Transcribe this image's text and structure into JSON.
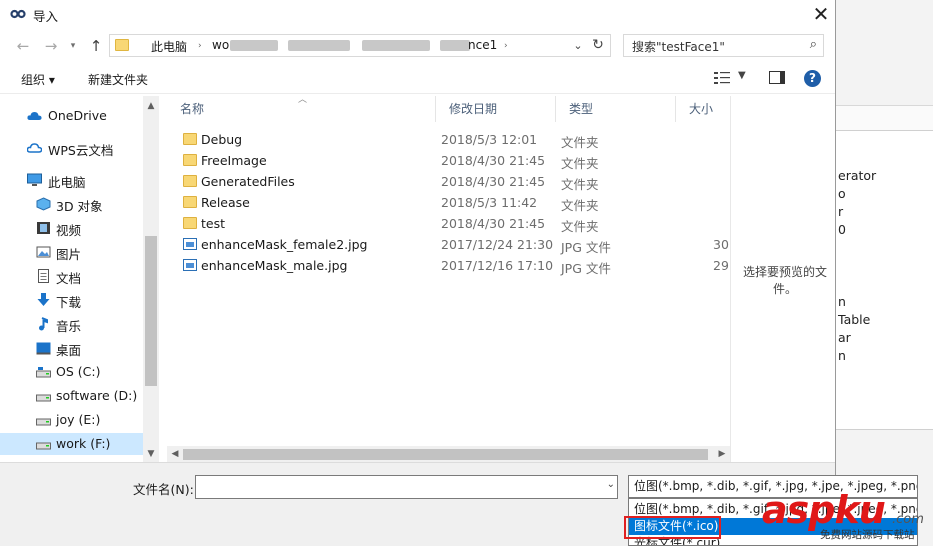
{
  "window": {
    "title": "导入"
  },
  "address": {
    "crumbs": [
      "此电脑",
      "wo",
      "nce1"
    ]
  },
  "search": {
    "placeholder": "搜索\"testFace1\""
  },
  "toolbar": {
    "organize": "组织 ▾",
    "new_folder": "新建文件夹"
  },
  "nav": {
    "items": [
      {
        "label": "OneDrive",
        "icon": "cloud-icon"
      },
      {
        "label": "WPS云文档",
        "icon": "cloud-icon"
      },
      {
        "label": "此电脑",
        "icon": "computer-icon"
      },
      {
        "label": "3D 对象",
        "icon": "cube-icon"
      },
      {
        "label": "视频",
        "icon": "video-icon"
      },
      {
        "label": "图片",
        "icon": "picture-icon"
      },
      {
        "label": "文档",
        "icon": "document-icon"
      },
      {
        "label": "下载",
        "icon": "download-icon"
      },
      {
        "label": "音乐",
        "icon": "music-icon"
      },
      {
        "label": "桌面",
        "icon": "desktop-icon"
      },
      {
        "label": "OS (C:)",
        "icon": "drive-icon"
      },
      {
        "label": "software (D:)",
        "icon": "drive-icon"
      },
      {
        "label": "joy (E:)",
        "icon": "drive-icon"
      },
      {
        "label": "work (F:)",
        "icon": "drive-icon",
        "selected": true
      }
    ]
  },
  "columns": {
    "name": "名称",
    "date": "修改日期",
    "type": "类型",
    "size": "大小"
  },
  "files": [
    {
      "name": "Debug",
      "date": "2018/5/3 12:01",
      "type": "文件夹",
      "size": "",
      "kind": "folder"
    },
    {
      "name": "FreeImage",
      "date": "2018/4/30 21:45",
      "type": "文件夹",
      "size": "",
      "kind": "folder"
    },
    {
      "name": "GeneratedFiles",
      "date": "2018/4/30 21:45",
      "type": "文件夹",
      "size": "",
      "kind": "folder"
    },
    {
      "name": "Release",
      "date": "2018/5/3 11:42",
      "type": "文件夹",
      "size": "",
      "kind": "folder"
    },
    {
      "name": "test",
      "date": "2018/4/30 21:45",
      "type": "文件夹",
      "size": "",
      "kind": "folder"
    },
    {
      "name": "enhanceMask_female2.jpg",
      "date": "2017/12/24 21:30",
      "type": "JPG 文件",
      "size": "30",
      "kind": "jpg"
    },
    {
      "name": "enhanceMask_male.jpg",
      "date": "2017/12/16 17:10",
      "type": "JPG 文件",
      "size": "29",
      "kind": "jpg"
    }
  ],
  "preview": {
    "text": "选择要预览的文件。"
  },
  "footer": {
    "filename_label": "文件名(N):",
    "filename_value": "",
    "filetype_selected": "位图(*.bmp, *.dib, *.gif, *.jpg, *.jpe, *.jpeg, *.png)",
    "filetype_options": [
      "位图(*.bmp, *.dib, *.gif, *.jpg, *.jpe, *.jpeg, *.png)",
      "图标文件(*.ico)",
      "光标文件(*.cur)"
    ]
  },
  "background": {
    "lines": [
      "erator",
      "o",
      "r",
      "0",
      "n",
      "Table",
      "ar",
      "n"
    ]
  },
  "watermark": {
    "brand": "aspku",
    "tld": ".com",
    "slogan": "免费网站源码下载站"
  },
  "colors": {
    "accent": "#0078d7",
    "selection": "#cce8ff",
    "highlight_box": "#e02020"
  }
}
